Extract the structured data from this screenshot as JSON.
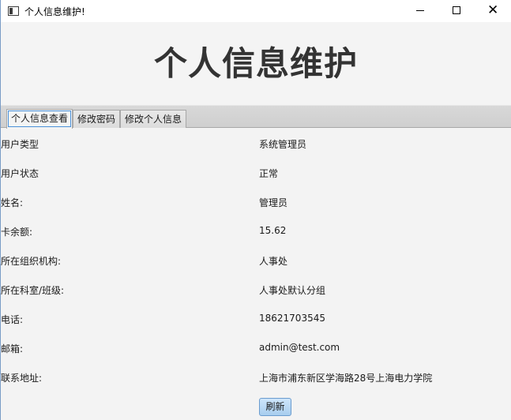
{
  "window": {
    "title": "个人信息维护!"
  },
  "header": {
    "title": "个人信息维护"
  },
  "tabs": [
    {
      "label": "个人信息查看",
      "active": true
    },
    {
      "label": "修改密码",
      "active": false
    },
    {
      "label": "修改个人信息",
      "active": false
    }
  ],
  "fields": [
    {
      "label": "用户类型",
      "value": "系统管理员"
    },
    {
      "label": "用户状态",
      "value": "正常"
    },
    {
      "label": "姓名:",
      "value": "管理员"
    },
    {
      "label": "卡余额:",
      "value": "15.62"
    },
    {
      "label": "所在组织机构:",
      "value": "人事处"
    },
    {
      "label": "所在科室/班级:",
      "value": "人事处默认分组"
    },
    {
      "label": "电话:",
      "value": "18621703545"
    },
    {
      "label": "邮箱:",
      "value": "admin@test.com"
    },
    {
      "label": "联系地址:",
      "value": "上海市浦东新区学海路28号上海电力学院"
    }
  ],
  "actions": {
    "refresh_label": "刷新"
  },
  "icons": {
    "app": "app-window-icon",
    "minimize": "minimize-icon",
    "maximize": "maximize-icon",
    "close": "close-icon",
    "close_glyph": "✕"
  }
}
